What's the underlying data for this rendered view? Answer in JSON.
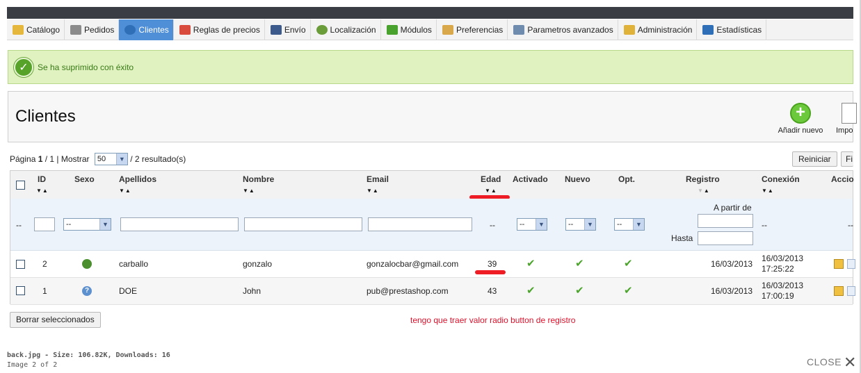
{
  "tabs": [
    {
      "label": "Catálogo",
      "icon": "folder-icon",
      "color": "#e5b73d"
    },
    {
      "label": "Pedidos",
      "icon": "cart-icon",
      "color": "#8b8b8b"
    },
    {
      "label": "Clientes",
      "icon": "user-icon",
      "color": "#2f6fb8",
      "active": true
    },
    {
      "label": "Reglas de precios",
      "icon": "price-rules-icon",
      "color": "#d94c3d"
    },
    {
      "label": "Envío",
      "icon": "truck-icon",
      "color": "#3c5a8b"
    },
    {
      "label": "Localización",
      "icon": "globe-icon",
      "color": "#6a9c3a"
    },
    {
      "label": "Módulos",
      "icon": "puzzle-icon",
      "color": "#4aa22e"
    },
    {
      "label": "Preferencias",
      "icon": "preferences-icon",
      "color": "#d8a84a"
    },
    {
      "label": "Parametros avanzados",
      "icon": "wrench-icon",
      "color": "#6f8cae"
    },
    {
      "label": "Administración",
      "icon": "key-icon",
      "color": "#e0b23a"
    },
    {
      "label": "Estadísticas",
      "icon": "stats-icon",
      "color": "#2f6fb8"
    }
  ],
  "success": {
    "message": "Se ha suprimido con éxito"
  },
  "page": {
    "title": "Clientes",
    "add_new": "Añadir nuevo",
    "import": "Impo"
  },
  "pagination": {
    "pagina_label": "Página ",
    "current": "1",
    "sep": " / 1 | Mostrar ",
    "per_page": "50",
    "results": " / 2 resultado(s)"
  },
  "actions": {
    "reset": "Reiniciar",
    "filter": "Fi",
    "delete_selected": "Borrar seleccionados"
  },
  "columns": {
    "id": "ID",
    "sexo": "Sexo",
    "apellidos": "Apellidos",
    "nombre": "Nombre",
    "email": "Email",
    "edad": "Edad",
    "activado": "Activado",
    "nuevo": "Nuevo",
    "opt": "Opt.",
    "registro": "Registro",
    "conexion": "Conexión",
    "acciones": "Accio"
  },
  "filters": {
    "dash": "--",
    "select_placeholder": "--",
    "registro_from": "A partir de",
    "registro_to": "Hasta"
  },
  "rows": [
    {
      "id": "2",
      "gender": "male",
      "apellidos": "carballo",
      "nombre": "gonzalo",
      "email": "gonzalocbar@gmail.com",
      "edad": "39",
      "activado": "✔",
      "nuevo": "✔",
      "opt": "✔",
      "registro": "16/03/2013",
      "conexion_date": "16/03/2013",
      "conexion_time": "17:25:22"
    },
    {
      "id": "1",
      "gender": "unknown",
      "apellidos": "DOE",
      "nombre": "John",
      "email": "pub@prestashop.com",
      "edad": "43",
      "activado": "✔",
      "nuevo": "✔",
      "opt": "✔",
      "registro": "16/03/2013",
      "conexion_date": "16/03/2013",
      "conexion_time": "17:00:19"
    }
  ],
  "note": "tengo que traer valor radio button de registro",
  "viewer": {
    "file_info": "back.jpg - Size: 106.82K, Downloads: 16",
    "image_index": "Image 2 of 2",
    "close": "CLOSE"
  },
  "colors": {
    "active_tab": "#4f8fd8",
    "success_bg": "#dff2bf",
    "check_green": "#4aa42a",
    "annotation_red": "#ee1c24"
  }
}
